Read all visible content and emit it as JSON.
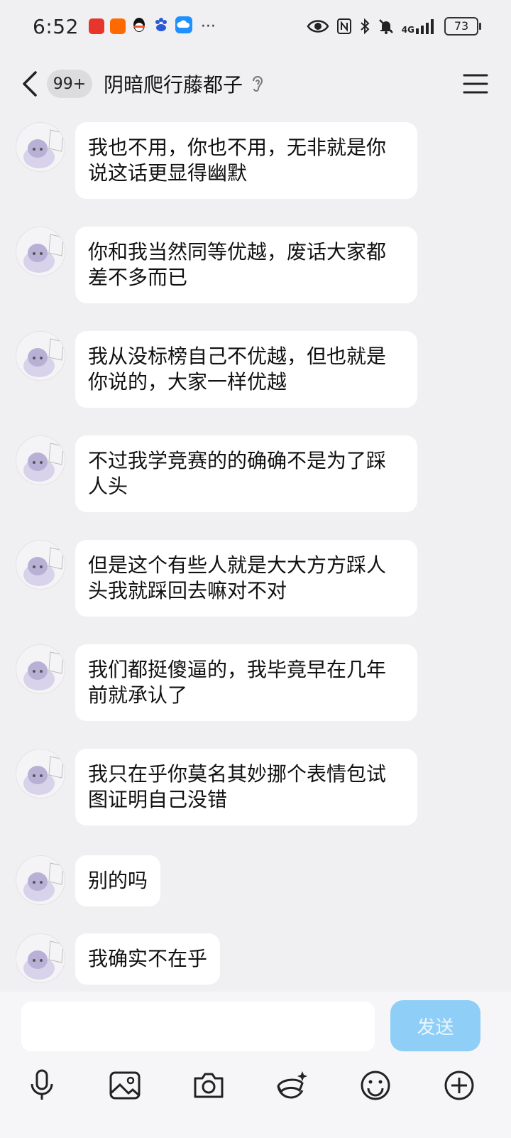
{
  "status_bar": {
    "time": "6:52",
    "more": "···",
    "network": "4G",
    "battery": "73"
  },
  "header": {
    "unread_badge": "99+",
    "title": "阴暗爬行藤都子"
  },
  "messages": [
    {
      "text": "我也不用，你也不用，无非就是你说这话更显得幽默"
    },
    {
      "text": "你和我当然同等优越，废话大家都差不多而已"
    },
    {
      "text": "我从没标榜自己不优越，但也就是你说的，大家一样优越"
    },
    {
      "text": "不过我学竞赛的的确确不是为了踩人头"
    },
    {
      "text": "但是这个有些人就是大大方方踩人头我就踩回去嘛对不对"
    },
    {
      "text": "我们都挺傻逼的，我毕竟早在几年前就承认了"
    },
    {
      "text": "我只在乎你莫名其妙挪个表情包试图证明自己没错"
    },
    {
      "text": "别的吗"
    },
    {
      "text": "我确实不在乎"
    }
  ],
  "input": {
    "value": "",
    "send_label": "发送"
  },
  "colors": {
    "background": "#f0f0f2",
    "bubble": "#ffffff",
    "send_button": "#8fcff7"
  }
}
